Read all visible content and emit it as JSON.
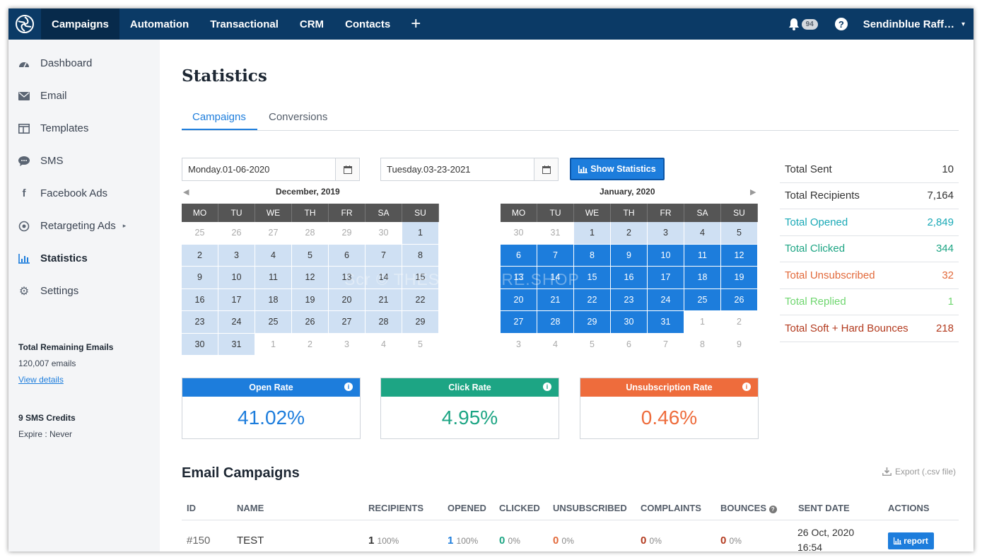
{
  "nav": {
    "items": [
      "Campaigns",
      "Automation",
      "Transactional",
      "CRM",
      "Contacts"
    ],
    "plus": "+",
    "notifications": "94",
    "help": "?",
    "account": "Sendinblue Raff…",
    "account_caret": "▾"
  },
  "sidebar": {
    "items": [
      "Dashboard",
      "Email",
      "Templates",
      "SMS",
      "Facebook Ads",
      "Retargeting Ads",
      "Statistics",
      "Settings"
    ],
    "remaining_title": "Total Remaining Emails",
    "remaining_value": "120,007 emails",
    "view_details": "View details",
    "sms_title": "9 SMS Credits",
    "sms_expire": "Expire : Never"
  },
  "page": {
    "title": "Statistics",
    "tabs": [
      "Campaigns",
      "Conversions"
    ]
  },
  "filters": {
    "start_date": "Monday.01-06-2020",
    "end_date": "Tuesday.03-23-2021",
    "show_button": "Show Statistics"
  },
  "calendar": {
    "days": [
      "MO",
      "TU",
      "WE",
      "TH",
      "FR",
      "SA",
      "SU"
    ],
    "left_title": "December, 2019",
    "right_title": "January, 2020",
    "left_cells": [
      "25",
      "26",
      "27",
      "28",
      "29",
      "30",
      "1",
      "2",
      "3",
      "4",
      "5",
      "6",
      "7",
      "8",
      "9",
      "10",
      "11",
      "12",
      "13",
      "14",
      "15",
      "16",
      "17",
      "18",
      "19",
      "20",
      "21",
      "22",
      "23",
      "24",
      "25",
      "26",
      "27",
      "28",
      "29",
      "30",
      "31",
      "1",
      "2",
      "3",
      "4",
      "5"
    ],
    "right_cells": [
      "30",
      "31",
      "1",
      "2",
      "3",
      "4",
      "5",
      "6",
      "7",
      "8",
      "9",
      "10",
      "11",
      "12",
      "13",
      "14",
      "15",
      "16",
      "17",
      "18",
      "19",
      "20",
      "21",
      "22",
      "23",
      "24",
      "25",
      "26",
      "27",
      "28",
      "29",
      "30",
      "31",
      "1",
      "2",
      "3",
      "4",
      "5",
      "6",
      "7",
      "8",
      "9"
    ]
  },
  "rates": [
    {
      "label": "Open Rate",
      "value": "41.02%",
      "color": "#1d7ddc",
      "text_color": "#1d7ddc"
    },
    {
      "label": "Click Rate",
      "value": "4.95%",
      "color": "#1da584",
      "text_color": "#1da584"
    },
    {
      "label": "Unsubscription Rate",
      "value": "0.46%",
      "color": "#ee6c3c",
      "text_color": "#ee6c3c"
    }
  ],
  "totals": [
    {
      "label": "Total Sent",
      "value": "10",
      "color": "#333333"
    },
    {
      "label": "Total Recipients",
      "value": "7,164",
      "color": "#333333"
    },
    {
      "label": "Total Opened",
      "value": "2,849",
      "color": "#19a9b6"
    },
    {
      "label": "Total Clicked",
      "value": "344",
      "color": "#1da584"
    },
    {
      "label": "Total Unsubscribed",
      "value": "32",
      "color": "#e2693a"
    },
    {
      "label": "Total Replied",
      "value": "1",
      "color": "#6fd66f"
    },
    {
      "label": "Total Soft + Hard Bounces",
      "value": "218",
      "color": "#b33a1e"
    }
  ],
  "campaigns": {
    "title": "Email Campaigns",
    "export": "Export (.csv file)",
    "headers": [
      "ID",
      "NAME",
      "RECIPIENTS",
      "OPENED",
      "CLICKED",
      "UNSUBSCRIBED",
      "COMPLAINTS",
      "BOUNCES",
      "SENT DATE",
      "ACTIONS"
    ],
    "row": {
      "id": "#150",
      "name": "TEST",
      "recipients": "1",
      "recipients_pct": "100%",
      "opened": "1",
      "opened_pct": "100%",
      "clicked": "0",
      "clicked_pct": "0%",
      "unsubscribed": "0",
      "unsubscribed_pct": "0%",
      "complaints": "0",
      "complaints_pct": "0%",
      "bounces": "0",
      "bounces_pct": "0%",
      "sent_date": "26 Oct, 2020",
      "sent_time": "16:54",
      "action": "report"
    }
  },
  "watermark": "Scr © THESOFTWARE.SHOP"
}
